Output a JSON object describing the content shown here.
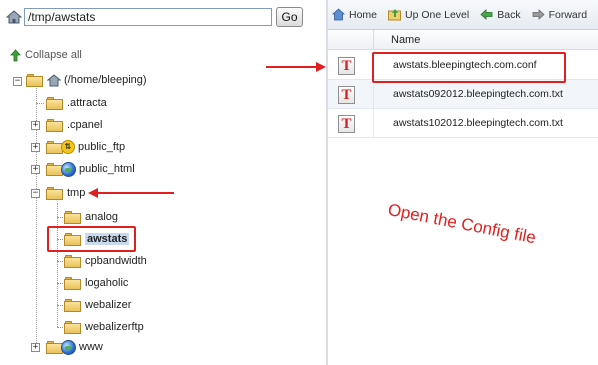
{
  "path_bar": {
    "value": "/tmp/awstats",
    "go_label": "Go"
  },
  "tree": {
    "collapse_label": "Collapse all",
    "root_label": "(/home/bleeping)",
    "items": [
      {
        "label": ".attracta",
        "type": "folder"
      },
      {
        "label": ".cpanel",
        "type": "folder"
      },
      {
        "label": "public_ftp",
        "type": "ftp"
      },
      {
        "label": "public_html",
        "type": "globe"
      },
      {
        "label": "tmp",
        "type": "folder"
      },
      {
        "label": "analog",
        "type": "folder"
      },
      {
        "label": "awstats",
        "type": "folder"
      },
      {
        "label": "cpbandwidth",
        "type": "folder"
      },
      {
        "label": "logaholic",
        "type": "folder"
      },
      {
        "label": "webalizer",
        "type": "folder"
      },
      {
        "label": "webalizerftp",
        "type": "folder"
      },
      {
        "label": "www",
        "type": "globe"
      }
    ]
  },
  "toolbar": {
    "home": "Home",
    "up": "Up One Level",
    "back": "Back",
    "forward": "Forward"
  },
  "file_list": {
    "column_name": "Name",
    "files": [
      {
        "name": "awstats.bleepingtech.com.conf",
        "icon": "T"
      },
      {
        "name": "awstats092012.bleepingtech.com.txt",
        "icon": "T"
      },
      {
        "name": "awstats102012.bleepingtech.com.txt",
        "icon": "T"
      }
    ]
  },
  "annotation": {
    "text": "Open the Config file"
  },
  "colors": {
    "highlight": "#e02020",
    "selected_bg": "#c9d9ee"
  }
}
